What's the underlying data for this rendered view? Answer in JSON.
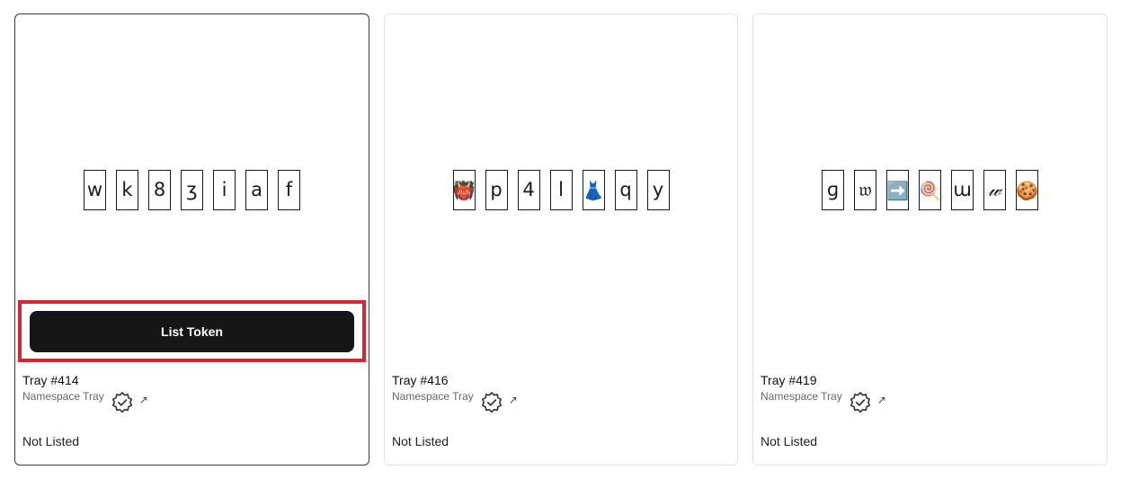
{
  "cards": [
    {
      "tiles": [
        {
          "char": "w",
          "kind": "text"
        },
        {
          "char": "k",
          "kind": "text"
        },
        {
          "char": "8",
          "kind": "text"
        },
        {
          "char": "ʒ",
          "kind": "text"
        },
        {
          "char": "i",
          "kind": "text"
        },
        {
          "char": "a",
          "kind": "text"
        },
        {
          "char": "f",
          "kind": "text"
        }
      ],
      "button_label": "List Token",
      "title": "Tray #414",
      "collection": "Namespace Tray",
      "verified_icon": "verified-badge-icon",
      "external_icon": "external-link-icon",
      "ext_glyph": "↗",
      "status": "Not Listed"
    },
    {
      "tiles": [
        {
          "char": "👹",
          "kind": "emoji"
        },
        {
          "char": "p",
          "kind": "text"
        },
        {
          "char": "4",
          "kind": "text"
        },
        {
          "char": "l",
          "kind": "text"
        },
        {
          "char": "👗",
          "kind": "emoji"
        },
        {
          "char": "q",
          "kind": "text"
        },
        {
          "char": "y",
          "kind": "text"
        }
      ],
      "title": "Tray #416",
      "collection": "Namespace Tray",
      "verified_icon": "verified-badge-icon",
      "external_icon": "external-link-icon",
      "ext_glyph": "↗",
      "status": "Not Listed"
    },
    {
      "tiles": [
        {
          "char": "ɡ",
          "kind": "text"
        },
        {
          "char": "𝔴",
          "kind": "text"
        },
        {
          "char": "➡️",
          "kind": "emoji"
        },
        {
          "char": "🍭",
          "kind": "emoji"
        },
        {
          "char": "ɯ",
          "kind": "text"
        },
        {
          "char": "𝓌",
          "kind": "script"
        },
        {
          "char": "🍪",
          "kind": "emoji"
        }
      ],
      "title": "Tray #419",
      "collection": "Namespace Tray",
      "verified_icon": "verified-badge-icon",
      "external_icon": "external-link-icon",
      "ext_glyph": "↗",
      "status": "Not Listed"
    }
  ],
  "colors": {
    "button_bg": "#161616",
    "highlight": "#d7262e"
  }
}
